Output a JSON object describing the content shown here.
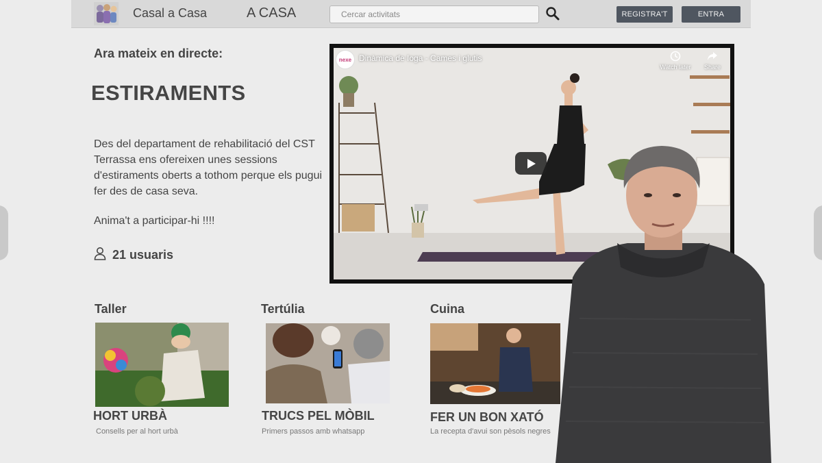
{
  "header": {
    "brand": "Casal a Casa",
    "nav_item": "A CASA",
    "search_placeholder": "Cercar activitats",
    "register_label": "REGISTRA'T",
    "login_label": "ENTRA"
  },
  "live": {
    "label": "Ara mateix en directe:",
    "title": "ESTIRAMENTS",
    "description": "Des del departament de rehabilitació del CST Terrassa ens  ofereixen unes sessions d'estiraments oberts a tothom perque els pugui fer des de casa seva.",
    "cta": "Anima't a participar-hi !!!!",
    "users": "21 usuaris"
  },
  "video": {
    "channel": "nexe",
    "title": "Dinàmica de Ioga - Cames i glutis",
    "watch_later": "Watch later",
    "share": "Share"
  },
  "categories": [
    {
      "label": "Taller",
      "title": "HORT URBÀ",
      "subtitle": "Consells per al hort urbà"
    },
    {
      "label": "Tertúlia",
      "title": "TRUCS PEL MÒBIL",
      "subtitle": "Primers passos amb whatsapp"
    },
    {
      "label": "Cuina",
      "title": "FER UN BON XATÓ",
      "subtitle": "La recepta d'avui son pèsols negres"
    }
  ],
  "colors": {
    "background": "#ececec",
    "header": "#d9d9d9",
    "button": "#4f5660",
    "text": "#444444"
  }
}
